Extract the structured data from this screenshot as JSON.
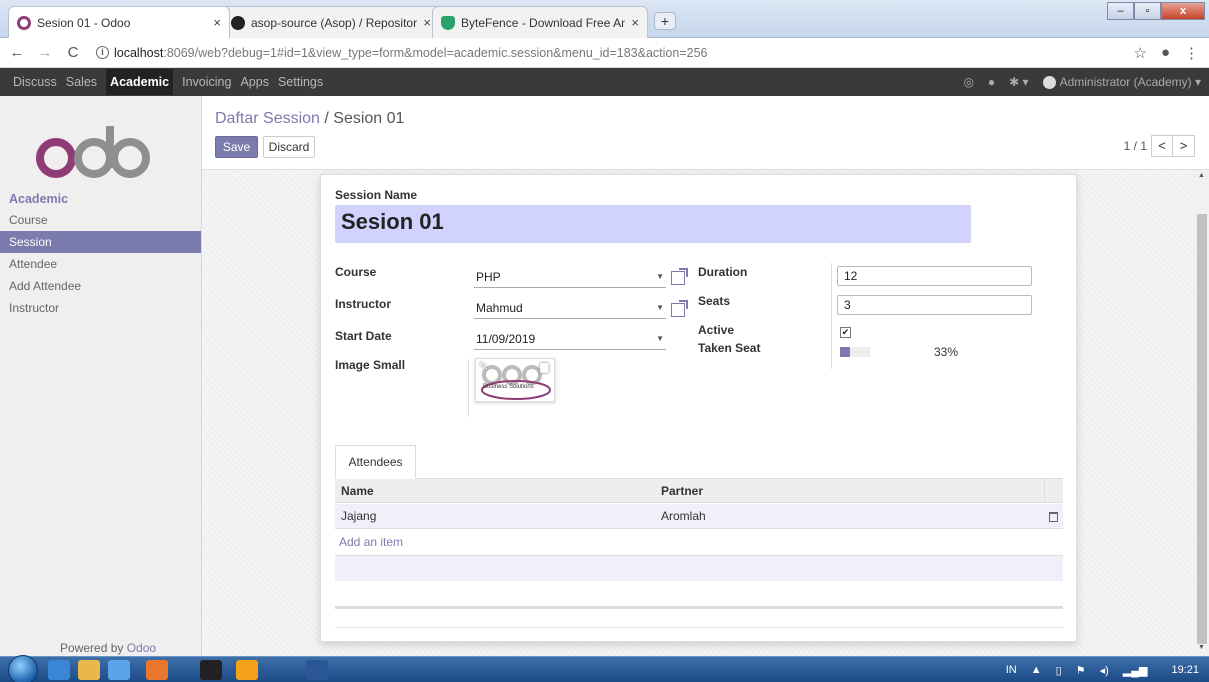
{
  "browser": {
    "tabs": [
      {
        "title": "Sesion 01 - Odoo",
        "active": true
      },
      {
        "title": "asop-source (Asop) / Repositorie",
        "active": false
      },
      {
        "title": "ByteFence - Download Free Antiv",
        "active": false
      }
    ],
    "new_tab": "+",
    "close_glyph": "×",
    "url": {
      "host": "localhost",
      "path": ":8069/web?debug=1#id=1&view_type=form&model=academic.session&menu_id=183&action=256"
    },
    "info_glyph": "i"
  },
  "odoo": {
    "top_menu": [
      {
        "label": "Discuss"
      },
      {
        "label": "Sales"
      },
      {
        "label": "Academic",
        "active": true
      },
      {
        "label": "Invoicing"
      },
      {
        "label": "Apps"
      },
      {
        "label": "Settings"
      }
    ],
    "user": "Administrator (Academy)",
    "sidebar": {
      "heading": "Academic",
      "items": [
        {
          "label": "Course"
        },
        {
          "label": "Session",
          "active": true
        },
        {
          "label": "Attendee"
        },
        {
          "label": "Add Attendee"
        },
        {
          "label": "Instructor"
        }
      ],
      "powered_prefix": "Powered by",
      "powered_brand": "Odoo"
    },
    "breadcrumb": {
      "parent": "Daftar Session",
      "separator": " / ",
      "current": "Sesion 01"
    },
    "buttons": {
      "save": "Save",
      "discard": "Discard"
    },
    "pager": {
      "value": "1 / 1",
      "prev": "<",
      "next": ">"
    },
    "form": {
      "session_name_label": "Session Name",
      "session_name": "Sesion 01",
      "course_label": "Course",
      "course": "PHP",
      "instructor_label": "Instructor",
      "instructor": "Mahmud",
      "start_date_label": "Start Date",
      "start_date": "11/09/2019",
      "image_label": "Image Small",
      "image_caption": "Business Solutions",
      "duration_label": "Duration",
      "duration": "12",
      "seats_label": "Seats",
      "seats": "3",
      "active_label": "Active",
      "active": true,
      "active_mark": "✔",
      "taken_seat_label": "Taken Seat",
      "taken_seat_percent": 33,
      "taken_seat_text": "33%"
    },
    "attendees": {
      "tab_label": "Attendees",
      "columns": [
        "Name",
        "Partner"
      ],
      "rows": [
        {
          "name": "Jajang",
          "partner": "Aromlah"
        }
      ],
      "add_item": "Add an item"
    }
  },
  "taskbar": {
    "lang": "IN",
    "time": "19:21"
  },
  "colors": {
    "accent": "#7c7bad",
    "topbar": "#3a3a3a",
    "title_bg": "#d2d2ff"
  }
}
